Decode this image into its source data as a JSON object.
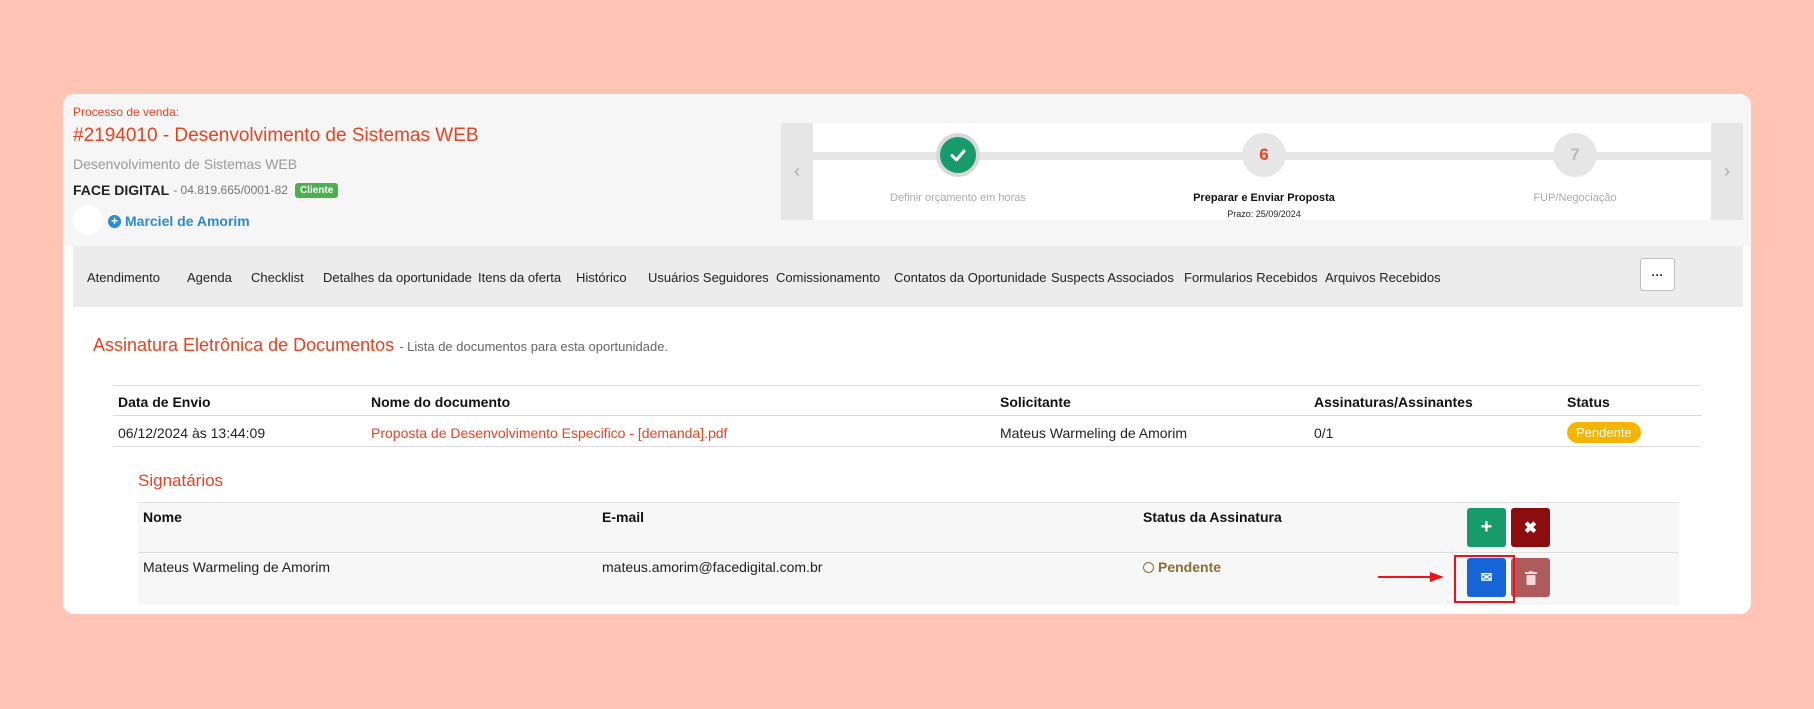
{
  "header": {
    "process_label": "Processo de venda:",
    "process_title": "#2194010 - Desenvolvimento de Sistemas WEB",
    "process_subtitle": "Desenvolvimento de Sistemas WEB",
    "company_name": "FACE DIGITAL",
    "company_cnpj": "- 04.819.665/0001-82",
    "company_badge": "Cliente",
    "owner_name": "Marciel de Amorim"
  },
  "stepper": {
    "steps": [
      {
        "number": "",
        "label": "Definir orçamento em horas",
        "state": "done"
      },
      {
        "number": "6",
        "label": "Preparar e Enviar Proposta",
        "deadline": "Prazo: 25/09/2024",
        "state": "current"
      },
      {
        "number": "7",
        "label": "FUP/Negociação",
        "state": "pending"
      }
    ]
  },
  "tabs": [
    "Atendimento",
    "Agenda",
    "Checklist",
    "Detalhes da oportunidade",
    "Itens da oferta",
    "Histórico",
    "Usuários Seguidores",
    "Comissionamento",
    "Contatos da Oportunidade",
    "Suspects Associados",
    "Formularios Recebidos",
    "Arquivos Recebidos"
  ],
  "tab_more": "···",
  "section": {
    "title": "Assinatura Eletrônica de Documentos",
    "description": "- Lista de documentos para esta oportunidade."
  },
  "documents": {
    "headers": [
      "Data de Envio",
      "Nome do documento",
      "Solicitante",
      "Assinaturas/Assinantes",
      "Status"
    ],
    "rows": [
      {
        "date": "06/12/2024 às 13:44:09",
        "name": "Proposta de Desenvolvimento Especifico - [demanda].pdf",
        "requester": "Mateus Warmeling de Amorim",
        "signatures": "0/1",
        "status": "Pendente"
      }
    ]
  },
  "signers": {
    "title": "Signatários",
    "headers": [
      "Nome",
      "E-mail",
      "Status da Assinatura"
    ],
    "rows": [
      {
        "name": "Mateus Warmeling de Amorim",
        "email": "mateus.amorim@facedigital.com.br",
        "status": "Pendente"
      }
    ]
  },
  "colors": {
    "accent": "#e8421e",
    "success": "#179a6c",
    "danger": "#8b0d0d",
    "primary": "#1565d6",
    "warning": "#f4b400",
    "background": "#ffc4b3"
  }
}
